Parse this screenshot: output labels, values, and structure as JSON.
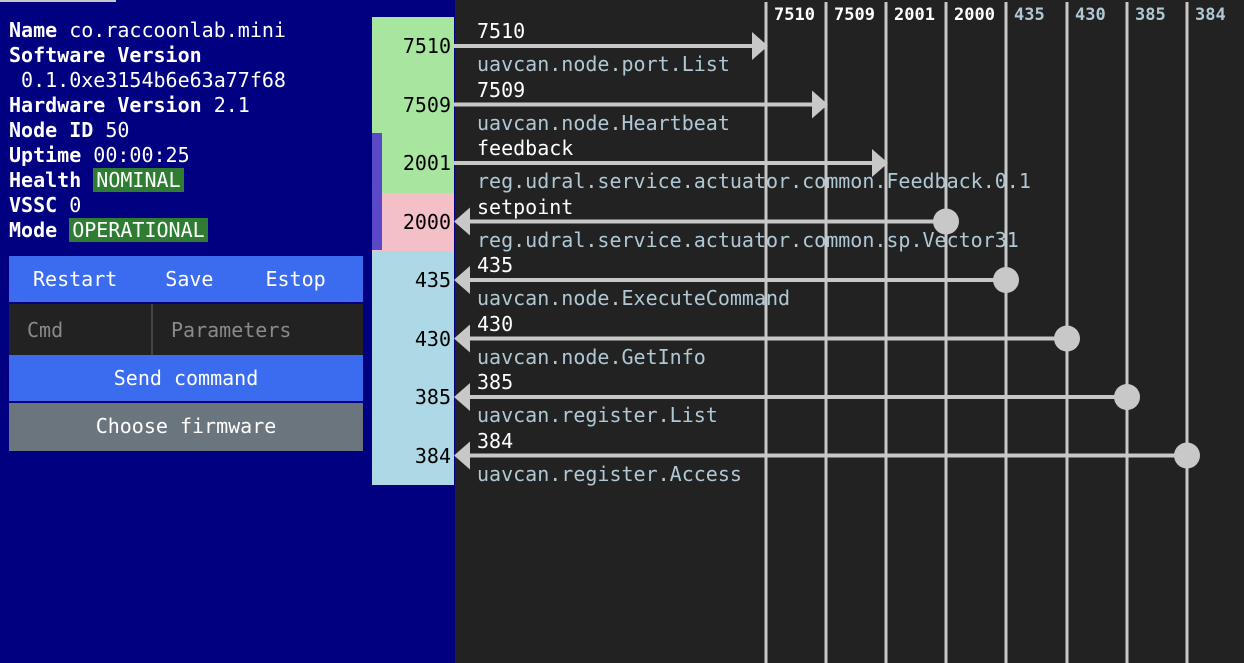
{
  "node": {
    "name_label": "Name",
    "name_value": "co.raccoonlab.mini",
    "software_label": "Software Version",
    "software_value": " 0.1.0xe3154b6e63a77f68",
    "hardware_label": "Hardware Version",
    "hardware_value": "2.1",
    "nodeid_label": "Node ID",
    "nodeid_value": "50",
    "uptime_label": "Uptime",
    "uptime_value": "00:00:25",
    "health_label": "Health",
    "health_value": "NOMINAL",
    "vssc_label": "VSSC",
    "vssc_value": "0",
    "mode_label": "Mode",
    "mode_value": "OPERATIONAL"
  },
  "controls": {
    "restart": "Restart",
    "save": "Save",
    "estop": "Estop",
    "cmd_placeholder": "Cmd",
    "params_placeholder": "Parameters",
    "send": "Send command",
    "firmware": "Choose firmware"
  },
  "ports": [
    {
      "id": "7510",
      "topic": "7510",
      "type": "uavcan.node.port.List",
      "kind": "pub",
      "color": "#a8e6a0"
    },
    {
      "id": "7509",
      "topic": "7509",
      "type": "uavcan.node.Heartbeat",
      "kind": "pub",
      "color": "#a8e6a0"
    },
    {
      "id": "2001",
      "topic": "feedback",
      "type": "reg.udral.service.actuator.common.Feedback.0.1",
      "kind": "pub",
      "color": "#a8e6a0"
    },
    {
      "id": "2000",
      "topic": "setpoint",
      "type": "reg.udral.service.actuator.common.sp.Vector31",
      "kind": "sub",
      "color": "#f4c0c8"
    },
    {
      "id": "435",
      "topic": "435",
      "type": "uavcan.node.ExecuteCommand",
      "kind": "srv",
      "color": "#add8e6"
    },
    {
      "id": "430",
      "topic": "430",
      "type": "uavcan.node.GetInfo",
      "kind": "srv",
      "color": "#add8e6"
    },
    {
      "id": "385",
      "topic": "385",
      "type": "uavcan.register.List",
      "kind": "srv",
      "color": "#add8e6"
    },
    {
      "id": "384",
      "topic": "384",
      "type": "uavcan.register.Access",
      "kind": "srv",
      "color": "#add8e6"
    }
  ],
  "headers": [
    {
      "label": "7510",
      "color": "#ffffff"
    },
    {
      "label": "7509",
      "color": "#ffffff"
    },
    {
      "label": "2001",
      "color": "#ffffff"
    },
    {
      "label": "2000",
      "color": "#ffffff"
    },
    {
      "label": "435",
      "color": "#b0c8d4"
    },
    {
      "label": "430",
      "color": "#b0c8d4"
    },
    {
      "label": "385",
      "color": "#b0c8d4"
    },
    {
      "label": "384",
      "color": "#b0c8d4"
    }
  ]
}
